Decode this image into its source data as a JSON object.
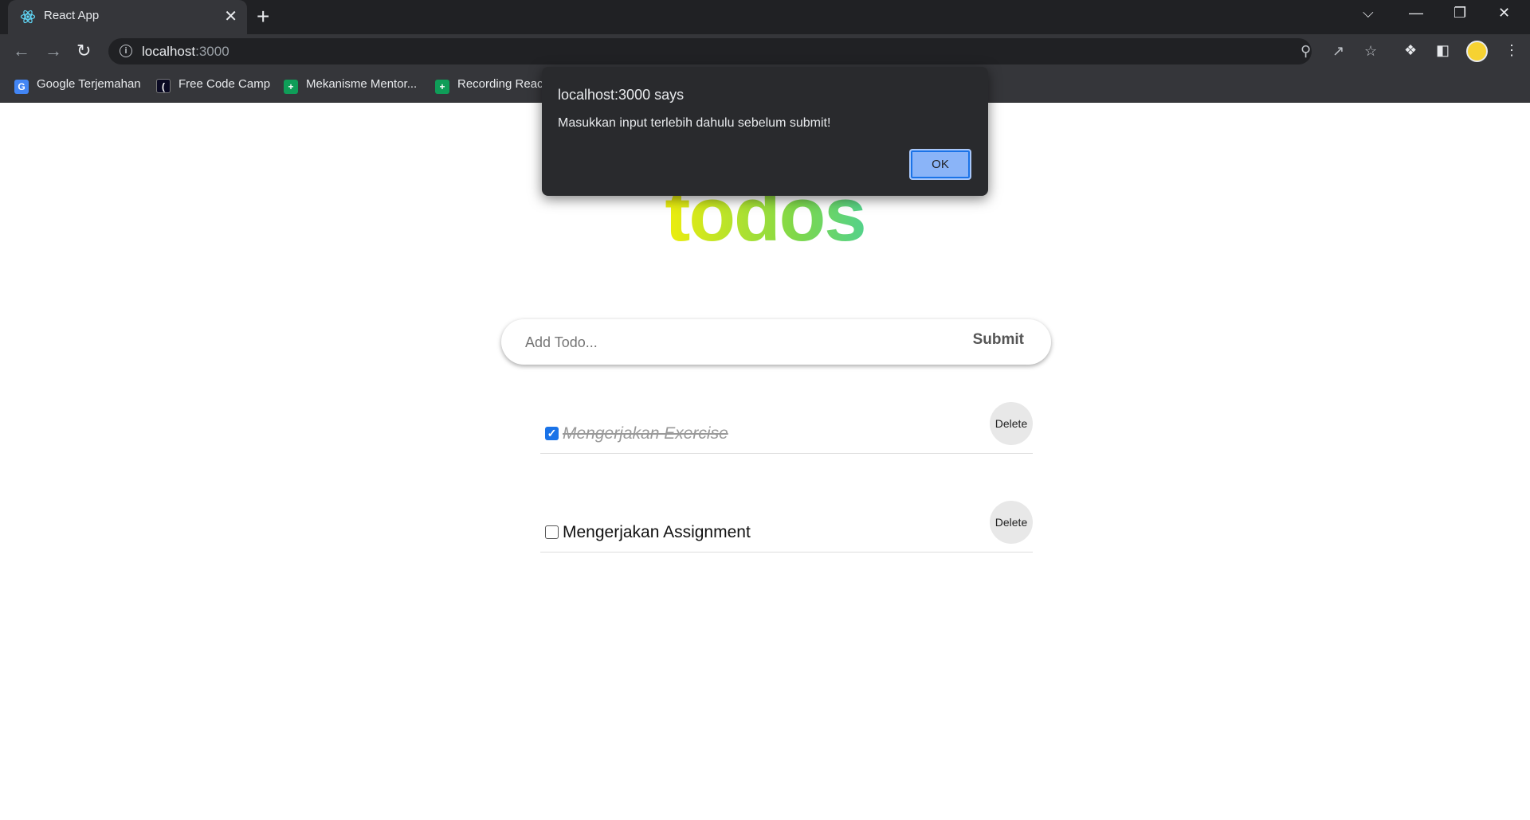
{
  "browser": {
    "tab_title": "React App",
    "tab_close": "✕",
    "new_tab": "+",
    "url_host": "localhost",
    "url_port": ":3000",
    "win_buttons": {
      "dropdown": "⌵",
      "minimize": "—",
      "restore": "❐",
      "close": "✕"
    },
    "bookmarks": [
      {
        "label": "Google Terjemahan",
        "icon": "google-translate-icon",
        "color": "#4285f4"
      },
      {
        "label": "Free Code Camp",
        "icon": "freecodecamp-icon",
        "color": "#0a0a23"
      },
      {
        "label": "Mekanisme Mentor...",
        "icon": "google-sheets-icon",
        "color": "#0f9d58"
      },
      {
        "label": "Recording Reac",
        "icon": "google-sheets-icon",
        "color": "#0f9d58"
      }
    ]
  },
  "page": {
    "heading": "todos",
    "input_placeholder": "Add Todo...",
    "input_value": "",
    "submit_label": "Submit",
    "todos": [
      {
        "text": "Mengerjakan Exercise",
        "completed": true,
        "delete_label": "Delete"
      },
      {
        "text": "Mengerjakan Assignment",
        "completed": false,
        "delete_label": "Delete"
      }
    ]
  },
  "dialog": {
    "title": "localhost:3000 says",
    "message": "Masukkan input terlebih dahulu sebelum submit!",
    "ok_label": "OK"
  },
  "colors": {
    "chrome_dark": "#202124",
    "chrome_toolbar": "#35363a",
    "dialog_bg": "#292a2d",
    "ok_button": "#8ab4f8",
    "checkbox_checked": "#1a73e8",
    "heading_gradient": [
      "#fff200",
      "#7fd84a",
      "#1fcad8",
      "#00b7ff"
    ]
  }
}
